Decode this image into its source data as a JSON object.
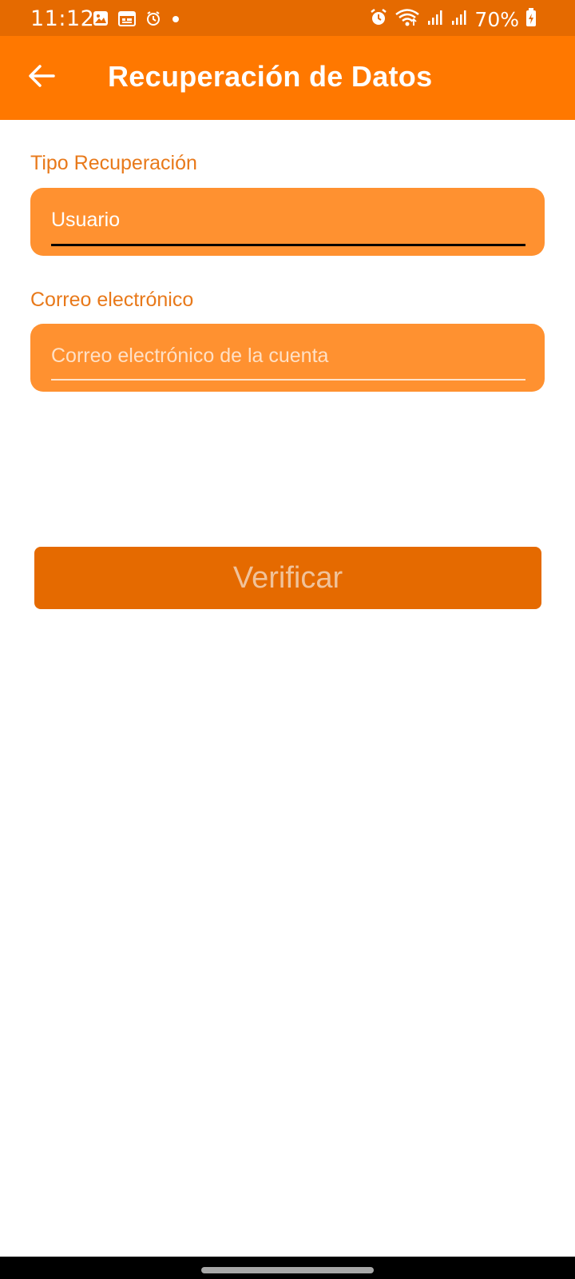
{
  "status_bar": {
    "time": "11:12",
    "battery": "70%",
    "left_icons": [
      "image-icon",
      "calendar-icon",
      "alarm-icon",
      "dot-icon"
    ],
    "right_icons": [
      "alarm-icon",
      "wifi-icon",
      "signal-icon",
      "signal-icon",
      "battery-icon"
    ]
  },
  "app_bar": {
    "title": "Recuperación de Datos",
    "back_icon": "arrow-left-icon",
    "color": "#FF7800"
  },
  "form": {
    "tipo": {
      "label": "Tipo Recuperación",
      "value": "Usuario"
    },
    "correo": {
      "label": "Correo electrónico",
      "placeholder": "Correo electrónico de la cuenta",
      "value": ""
    },
    "verify_label": "Verificar"
  },
  "colors": {
    "status_bar": "#E56A00",
    "accent": "#FF7800",
    "field_fill": "#FF9130",
    "label": "#E8791A",
    "button": "#E56A00"
  }
}
